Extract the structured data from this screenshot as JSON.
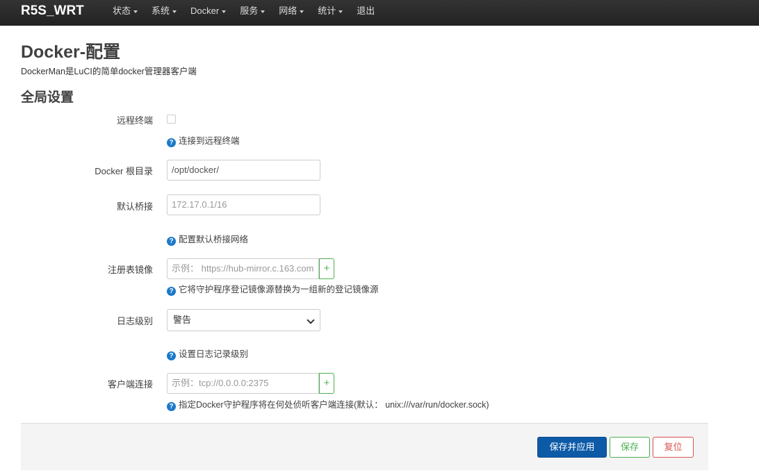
{
  "brand": "R5S_WRT",
  "nav": [
    {
      "label": "状态",
      "dropdown": true
    },
    {
      "label": "系统",
      "dropdown": true
    },
    {
      "label": "Docker",
      "dropdown": true
    },
    {
      "label": "服务",
      "dropdown": true
    },
    {
      "label": "网络",
      "dropdown": true
    },
    {
      "label": "统计",
      "dropdown": true
    },
    {
      "label": "退出",
      "dropdown": false
    }
  ],
  "page": {
    "title": "Docker-配置",
    "description": "DockerMan是LuCI的简单docker管理器客户端",
    "section_title": "全局设置"
  },
  "fields": {
    "remote_terminal": {
      "label": "远程终端",
      "checked": false,
      "help": "连接到远程终端"
    },
    "docker_root": {
      "label": "Docker 根目录",
      "value": "/opt/docker/"
    },
    "default_bridge": {
      "label": "默认桥接",
      "placeholder": "172.17.0.1/16",
      "help": "配置默认桥接网络"
    },
    "registry_mirror": {
      "label": "注册表镜像",
      "placeholder": "示例： https://hub-mirror.c.163.com",
      "add": "+",
      "help": "它将守护程序登记镜像源替换为一组新的登记镜像源"
    },
    "log_level": {
      "label": "日志级别",
      "selected": "警告",
      "help": "设置日志记录级别"
    },
    "client_connection": {
      "label": "客户端连接",
      "placeholder": "示例：tcp://0.0.0.0:2375",
      "add": "+",
      "help": "指定Docker守护程序将在何处侦听客户端连接(默认： unix:///var/run/docker.sock)"
    }
  },
  "help_icon": "question-circle-icon",
  "buttons": {
    "save_apply": "保存并应用",
    "save": "保存",
    "reset": "复位"
  },
  "colors": {
    "primary": "#0d5aa7",
    "success": "#4caf50",
    "danger": "#d9534f",
    "help_icon": "#1c79c9",
    "navbar": "#282828"
  }
}
